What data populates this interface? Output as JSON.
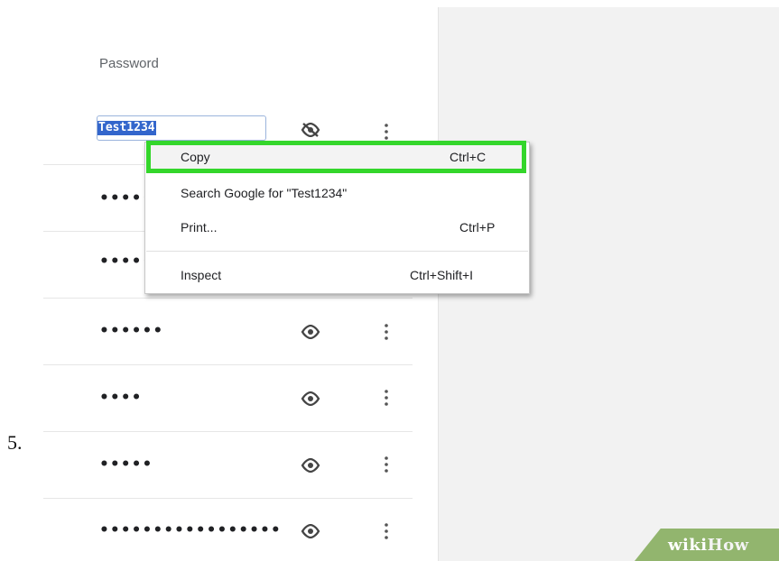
{
  "step_number": "5.",
  "password_column": {
    "header": "Password",
    "revealed_value": "Test1234",
    "rows": [
      {
        "masked": "•••••"
      },
      {
        "masked": "•••••"
      },
      {
        "masked": "••••••"
      },
      {
        "masked": "••••"
      },
      {
        "masked": "•••••"
      },
      {
        "masked": "•••••••••••••••••"
      }
    ]
  },
  "icons": {
    "reveal_off": "eye-slash-icon",
    "reveal": "eye-icon",
    "more": "more-vertical-icon"
  },
  "context_menu": {
    "items": [
      {
        "label": "Copy",
        "shortcut": "Ctrl+C",
        "highlighted": true
      },
      {
        "label": "Search Google for \"Test1234\"",
        "shortcut": ""
      },
      {
        "label": "Print...",
        "shortcut": "Ctrl+P"
      },
      {
        "label": "Inspect",
        "shortcut": "Ctrl+Shift+I"
      }
    ]
  },
  "colors": {
    "highlight_border": "#34d62b",
    "selection": "#3366cc",
    "badge": "#92b56e"
  },
  "watermark": {
    "part1": "wiki",
    "part2": "How"
  }
}
